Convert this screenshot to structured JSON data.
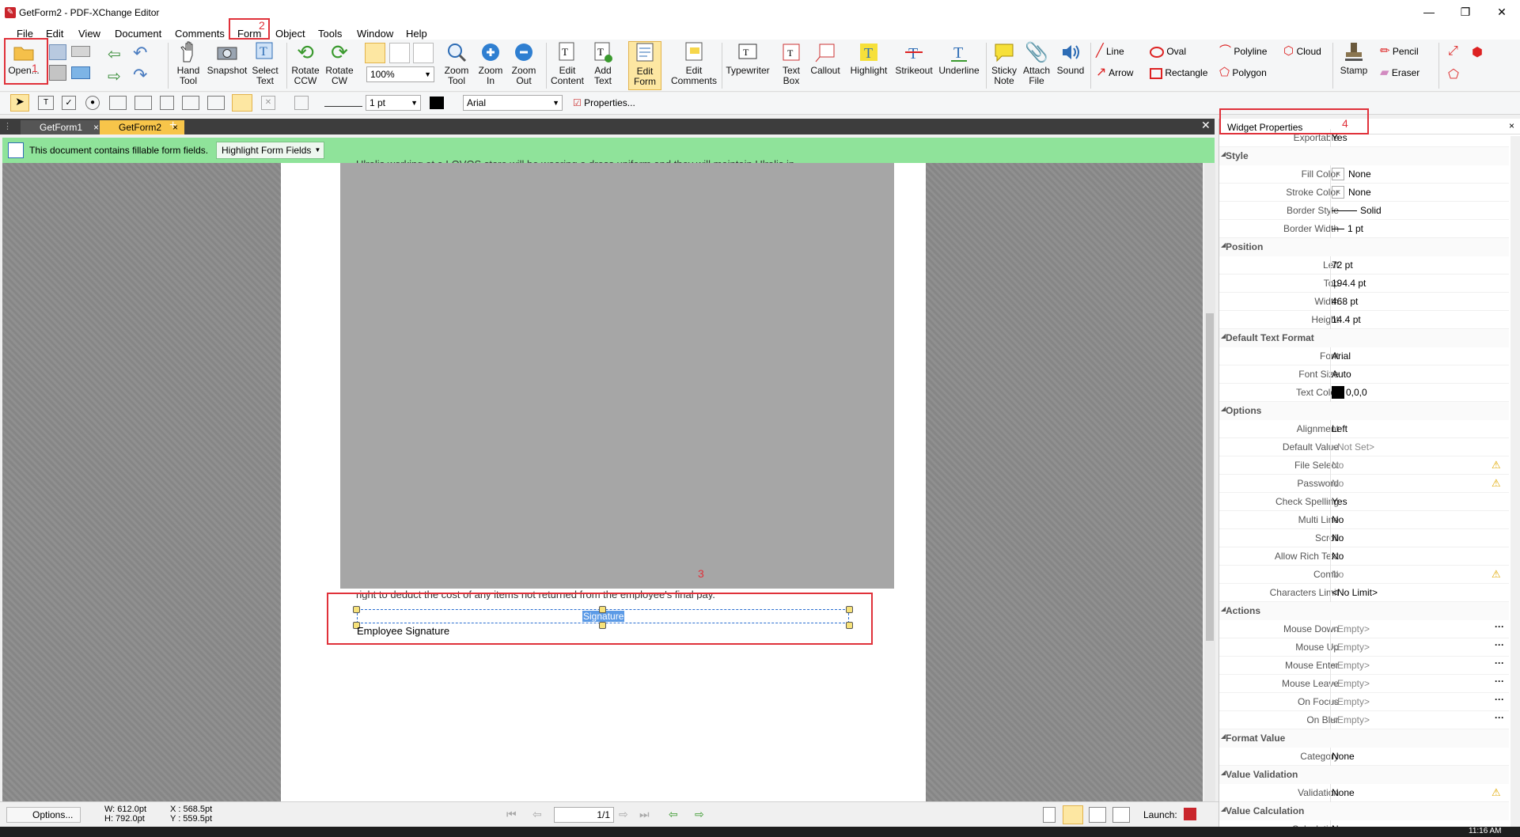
{
  "window": {
    "title": "GetForm2 - PDF-XChange Editor",
    "clock": "11:16 AM"
  },
  "menu": [
    "File",
    "Edit",
    "View",
    "Document",
    "Comments",
    "Form",
    "Object",
    "Tools",
    "Window",
    "Help"
  ],
  "ribbon": {
    "open": "Open...",
    "hand_tool": "Hand\nTool",
    "snapshot": "Snapshot",
    "select_text": "Select\nText",
    "rotate_ccw": "Rotate\nCCW",
    "rotate_cw": "Rotate\nCW",
    "zoom_value": "100%",
    "zoom_tool": "Zoom\nTool",
    "zoom_in": "Zoom\nIn",
    "zoom_out": "Zoom\nOut",
    "edit_content": "Edit\nContent",
    "add_text": "Add\nText",
    "edit_form": "Edit\nForm",
    "edit_comments": "Edit\nComments",
    "typewriter": "Typewriter",
    "text_box": "Text\nBox",
    "callout": "Callout",
    "highlight": "Highlight",
    "strikeout": "Strikeout",
    "underline": "Underline",
    "sticky_note": "Sticky\nNote",
    "attach_file": "Attach\nFile",
    "sound": "Sound",
    "line": "Line",
    "arrow": "Arrow",
    "oval": "Oval",
    "rectangle": "Rectangle",
    "polyline": "Polyline",
    "polygon": "Polygon",
    "cloud": "Cloud",
    "stamp": "Stamp",
    "pencil": "Pencil",
    "eraser": "Eraser"
  },
  "toolbar2": {
    "line_width": "1 pt",
    "font": "Arial",
    "properties": "Properties..."
  },
  "tabs": [
    "GetForm1",
    "GetForm2"
  ],
  "banner": {
    "text": "This document contains fillable form fields.",
    "button": "Highlight Form Fields"
  },
  "document": {
    "top_text": "Ulrolis working at a LOVOS store will be wearing a dress uniform and they will maintain Ulrolis in",
    "text_above_field": "right to deduct the cost of any items not returned from the employee's final pay.",
    "field_name": "Signature",
    "field_label": "Employee Signature"
  },
  "annotations": {
    "n1": "1",
    "n2": "2",
    "n3": "3",
    "n4": "4"
  },
  "panel": {
    "title": "Widget Properties",
    "rows": [
      {
        "type": "val",
        "label": "Exportable",
        "value": "Yes"
      },
      {
        "type": "cat",
        "label": "Style"
      },
      {
        "type": "val",
        "label": "Fill Color",
        "value": "None"
      },
      {
        "type": "val",
        "label": "Stroke Color",
        "value": "None"
      },
      {
        "type": "val",
        "label": "Border Style",
        "value": "Solid"
      },
      {
        "type": "val",
        "label": "Border Width",
        "value": "1 pt"
      },
      {
        "type": "cat",
        "label": "Position"
      },
      {
        "type": "val",
        "label": "Left",
        "value": "72 pt"
      },
      {
        "type": "val",
        "label": "Top",
        "value": "194.4 pt"
      },
      {
        "type": "val",
        "label": "Width",
        "value": "468 pt"
      },
      {
        "type": "val",
        "label": "Height",
        "value": "14.4 pt"
      },
      {
        "type": "cat",
        "label": "Default Text Format"
      },
      {
        "type": "val",
        "label": "Font",
        "value": "Arial"
      },
      {
        "type": "val",
        "label": "Font Size",
        "value": "Auto"
      },
      {
        "type": "val",
        "label": "Text Color",
        "value": "0,0,0"
      },
      {
        "type": "cat",
        "label": "Options"
      },
      {
        "type": "val",
        "label": "Alignment",
        "value": "Left"
      },
      {
        "type": "val",
        "label": "Default Value",
        "value": "<Not Set>",
        "gray": true
      },
      {
        "type": "val",
        "label": "File Select",
        "value": "No",
        "gray": true,
        "warn": true
      },
      {
        "type": "val",
        "label": "Password",
        "value": "No",
        "gray": true,
        "warn": true
      },
      {
        "type": "val",
        "label": "Check Spelling",
        "value": "Yes"
      },
      {
        "type": "val",
        "label": "Multi Line",
        "value": "No"
      },
      {
        "type": "val",
        "label": "Scroll",
        "value": "No"
      },
      {
        "type": "val",
        "label": "Allow Rich Text",
        "value": "No"
      },
      {
        "type": "val",
        "label": "Comb",
        "value": "No",
        "gray": true,
        "warn": true
      },
      {
        "type": "val",
        "label": "Characters Limit",
        "value": "<No Limit>"
      },
      {
        "type": "cat",
        "label": "Actions"
      },
      {
        "type": "val",
        "label": "Mouse Down",
        "value": "<Empty>",
        "gray": true,
        "dots": true
      },
      {
        "type": "val",
        "label": "Mouse Up",
        "value": "<Empty>",
        "gray": true,
        "dots": true
      },
      {
        "type": "val",
        "label": "Mouse Enter",
        "value": "<Empty>",
        "gray": true,
        "dots": true
      },
      {
        "type": "val",
        "label": "Mouse Leave",
        "value": "<Empty>",
        "gray": true,
        "dots": true
      },
      {
        "type": "val",
        "label": "On Focus",
        "value": "<Empty>",
        "gray": true,
        "dots": true
      },
      {
        "type": "val",
        "label": "On Blur",
        "value": "<Empty>",
        "gray": true,
        "dots": true
      },
      {
        "type": "cat",
        "label": "Format Value"
      },
      {
        "type": "val",
        "label": "Category",
        "value": "None"
      },
      {
        "type": "cat",
        "label": "Value Validation"
      },
      {
        "type": "val",
        "label": "Validation",
        "value": "None",
        "warn": true
      },
      {
        "type": "cat",
        "label": "Value Calculation"
      },
      {
        "type": "val",
        "label": "Calculation",
        "value": "None"
      }
    ]
  },
  "status": {
    "options": "Options...",
    "w": "W: 612.0pt",
    "h": "H: 792.0pt",
    "x": "X : 568.5pt",
    "y": "Y : 559.5pt",
    "page": "1/1",
    "launch": "Launch:"
  }
}
